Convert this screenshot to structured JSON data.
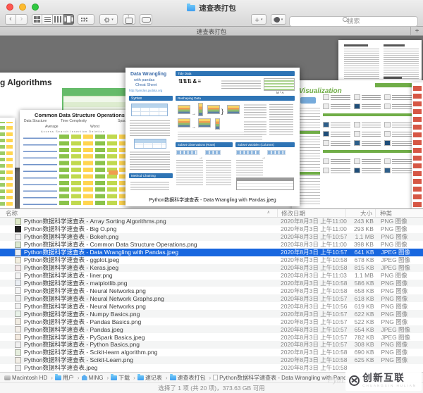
{
  "window": {
    "title": "速查表打包"
  },
  "toolbar": {
    "search_placeholder": "搜索"
  },
  "tabbar": {
    "tab_title": "速查表打包",
    "new_tab_label": "+"
  },
  "icons": {
    "back": "‹",
    "forward": "›",
    "view_grid": "grid-squares",
    "view_list": "list-lines",
    "view_columns": "column-bars",
    "view_coverflow": "coverflow-bars",
    "arrange": "dot-grid",
    "action": "gear",
    "share": "box-up-arrow",
    "tag_pill": "pill-outline",
    "add": "+",
    "tags": "color-blob",
    "search": "magnifier",
    "sort_asc": "∧",
    "path_separator": "›"
  },
  "coverflow": {
    "selected_caption": "Python数据科学速查表 - Data Wrangling with Pandas.jpeg",
    "sheets": {
      "array_sorting": {
        "title_fragment": "g Algorithms"
      },
      "common_ops": {
        "title": "Common Data Structure Operations",
        "col_group_1": "Data Structure",
        "col_group_2": "Time Complexity",
        "col_group_3": "Space Complexity",
        "sub_1": "Average",
        "sub_2": "Worst",
        "chip_headers": "Access   Search   Insertion   Deletion"
      },
      "pandas": {
        "title": "Data Wrangling",
        "subtitle1": "with pandas",
        "subtitle2": "Cheat Sheet",
        "url": "http://pandas.pydata.org",
        "tidy_note": "M * A",
        "sections": {
          "syntax": "Syntax",
          "tidy": "Tidy Data",
          "reshaping": "Reshaping Data",
          "subset_rows": "Subset Observations (Rows)",
          "subset_cols": "Subset Variables (Columns)",
          "method": "Method Chaining"
        }
      },
      "visualization": {
        "title": "Visualization"
      }
    }
  },
  "list": {
    "columns": [
      "名称",
      "修改日期",
      "大小",
      "种类"
    ],
    "rows": [
      {
        "name": "Python数据科学速查表 - Array Sorting Algorithms.png",
        "date": "2020年8月3日 上午11:00",
        "size": "243 KB",
        "kind": "PNG 图像",
        "thumb": "#dde8c8"
      },
      {
        "name": "Python数据科学速查表 - Big O.png",
        "date": "2020年8月3日 上午11:00",
        "size": "293 KB",
        "kind": "PNG 图像",
        "thumb": "#222222"
      },
      {
        "name": "Python数据科学速查表 - Bokeh.png",
        "date": "2020年8月3日 上午10:57",
        "size": "1.1 MB",
        "kind": "PNG 图像",
        "thumb": "#f2f2f2"
      },
      {
        "name": "Python数据科学速查表 - Common Data Structure Operations.png",
        "date": "2020年8月3日 上午11:00",
        "size": "398 KB",
        "kind": "PNG 图像",
        "thumb": "#dce9d2"
      },
      {
        "name": "Python数据科学速查表 - Data Wrangling with Pandas.jpeg",
        "date": "2020年8月3日 上午10:57",
        "size": "641 KB",
        "kind": "JPEG 图像",
        "thumb": "#e8eef6",
        "selected": true
      },
      {
        "name": "Python数据科学速查表 - ggplot.jpeg",
        "date": "2020年8月3日 上午10:58",
        "size": "678 KB",
        "kind": "JPEG 图像",
        "thumb": "#f3efe0"
      },
      {
        "name": "Python数据科学速查表 - Keras.jpeg",
        "date": "2020年8月3日 上午10:58",
        "size": "815 KB",
        "kind": "JPEG 图像",
        "thumb": "#f3e9e9"
      },
      {
        "name": "Python数据科学速查表 - liner.png",
        "date": "2020年8月3日 上午11:03",
        "size": "1.1 MB",
        "kind": "PNG 图像",
        "thumb": "#f4f4f4"
      },
      {
        "name": "Python数据科学速查表 - matplotlib.png",
        "date": "2020年8月3日 上午10:58",
        "size": "586 KB",
        "kind": "PNG 图像",
        "thumb": "#eaeef3"
      },
      {
        "name": "Python数据科学速查表 - Neural Networks.png",
        "date": "2020年8月3日 上午10:58",
        "size": "658 KB",
        "kind": "PNG 图像",
        "thumb": "#f4f4f4"
      },
      {
        "name": "Python数据科学速查表 - Neural Network Graphs.png",
        "date": "2020年8月3日 上午10:57",
        "size": "618 KB",
        "kind": "PNG 图像",
        "thumb": "#efefef"
      },
      {
        "name": "Python数据科学速查表 - Neural Networks.png",
        "date": "2020年8月3日 上午10:56",
        "size": "619 KB",
        "kind": "PNG 图像",
        "thumb": "#f2f2f2"
      },
      {
        "name": "Python数据科学速查表 - Numpy Basics.png",
        "date": "2020年8月3日 上午10:57",
        "size": "622 KB",
        "kind": "PNG 图像",
        "thumb": "#e8f1e8"
      },
      {
        "name": "Python数据科学速查表 - Pandas Basics.png",
        "date": "2020年8月3日 上午10:57",
        "size": "522 KB",
        "kind": "PNG 图像",
        "thumb": "#f1ece2"
      },
      {
        "name": "Python数据科学速查表 - Pandas.jpeg",
        "date": "2020年8月3日 上午10:57",
        "size": "654 KB",
        "kind": "JPEG 图像",
        "thumb": "#f4efe9"
      },
      {
        "name": "Python数据科学速查表 - PySpark Basics.jpeg",
        "date": "2020年8月3日 上午10:57",
        "size": "782 KB",
        "kind": "JPEG 图像",
        "thumb": "#f5ece2"
      },
      {
        "name": "Python数据科学速查表 - Python Basics.png",
        "date": "2020年8月3日 上午10:57",
        "size": "308 KB",
        "kind": "PNG 图像",
        "thumb": "#f0f0f0"
      },
      {
        "name": "Python数据科学速查表 - Scikit-learn algorithm.png",
        "date": "2020年8月3日 上午10:58",
        "size": "690 KB",
        "kind": "PNG 图像",
        "thumb": "#e6eede"
      },
      {
        "name": "Python数据科学速查表 - Scikit-Learn.png",
        "date": "2020年8月3日 上午10:58",
        "size": "625 KB",
        "kind": "PNG 图像",
        "thumb": "#f2eee6"
      },
      {
        "name": "Python数据科学速查表.jpeg",
        "date": "2020年8月3日 上午10:58",
        "size": "",
        "kind": "",
        "thumb": "#efefef"
      }
    ]
  },
  "pathbar": {
    "items": [
      {
        "label": "Macintosh HD",
        "icon": "disk"
      },
      {
        "label": "用户",
        "icon": "folder"
      },
      {
        "label": "MING",
        "icon": "home"
      },
      {
        "label": "下载",
        "icon": "folder"
      },
      {
        "label": "速记表",
        "icon": "folder"
      },
      {
        "label": "速查表打包",
        "icon": "folder"
      },
      {
        "label": "Python数据科学速查表 - Data Wrangling with Pandas.jpeg",
        "icon": "file"
      }
    ]
  },
  "statusbar": {
    "text": "选择了 1 项 (共 20 项)，373.63 GB 可用"
  },
  "watermark": {
    "brand": "创新互联",
    "subtext": "CHUANGXIN HULIAN",
    "faint_text": "Pyth"
  },
  "colors": {
    "selection_blue": "#1867df",
    "coverflow_background": "#707070",
    "pandas_header_blue": "#2e74b5",
    "ggplot_green": "#70ad47",
    "folder_blue": "#3e9ef0",
    "watermark_gray": "#45454b"
  }
}
